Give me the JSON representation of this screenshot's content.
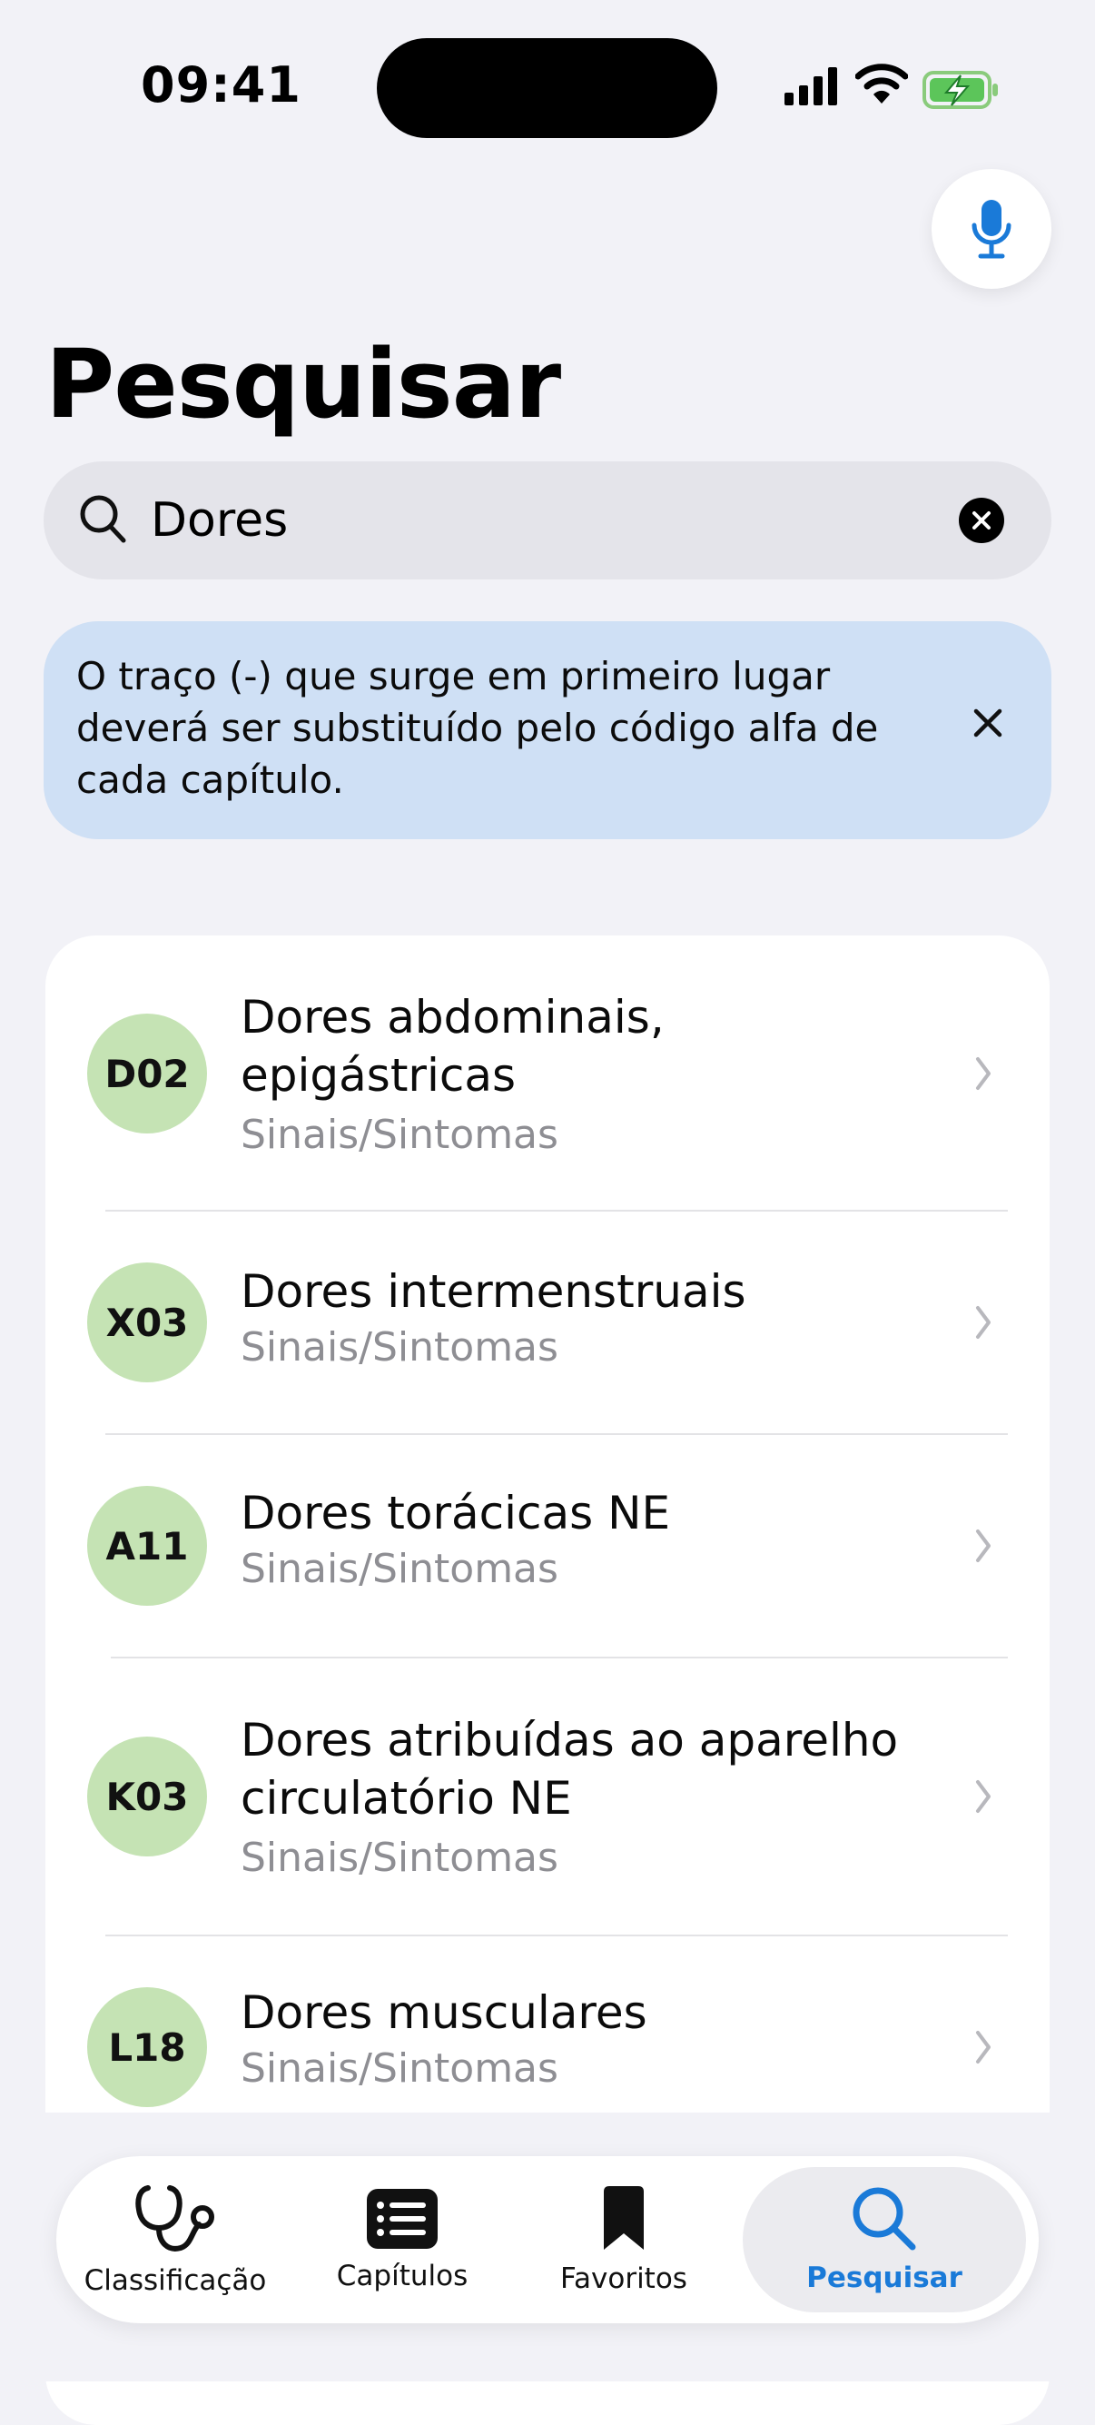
{
  "status_bar": {
    "time": "09:41"
  },
  "page": {
    "title": "Pesquisar"
  },
  "search": {
    "value": "Dores"
  },
  "info_banner": {
    "text": "O traço (-) que surge em primeiro lugar deverá ser substituído pelo código alfa de cada capítulo."
  },
  "results": [
    {
      "code": "D02",
      "title": "Dores abdominais, epigástricas",
      "category": "Sinais/Sintomas"
    },
    {
      "code": "X03",
      "title": "Dores intermenstruais",
      "category": "Sinais/Sintomas"
    },
    {
      "code": "A11",
      "title": "Dores torácicas NE",
      "category": "Sinais/Sintomas"
    },
    {
      "code": "K03",
      "title": "Dores atribuídas ao aparelho circulatório NE",
      "category": "Sinais/Sintomas"
    },
    {
      "code": "L18",
      "title": "Dores musculares",
      "category": "Sinais/Sintomas"
    }
  ],
  "tabs": [
    {
      "label": "Classificação",
      "icon": "stethoscope-icon"
    },
    {
      "label": "Capítulos",
      "icon": "list-icon"
    },
    {
      "label": "Favoritos",
      "icon": "bookmark-icon"
    },
    {
      "label": "Pesquisar",
      "icon": "search-icon"
    }
  ],
  "colors": {
    "accent": "#1a7ad8",
    "code_badge": "#c5e3b4",
    "banner": "#cfe0f5"
  }
}
